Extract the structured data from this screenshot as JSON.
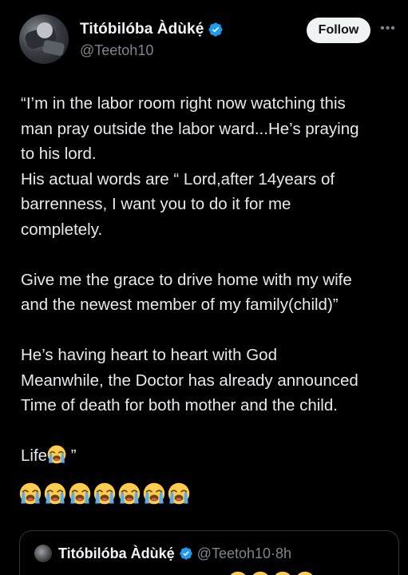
{
  "author": {
    "display_name": "Titóbilóba Àdùkẹ́",
    "handle": "@Teetoh10",
    "verified_icon": "verified-badge-icon",
    "avatar": "avatar-image"
  },
  "actions": {
    "follow_label": "Follow",
    "more_icon": "more-options-icon"
  },
  "tweet": {
    "lines": [
      "“I’m in the labor room right now watching this",
      "man pray outside the labor ward...He’s praying",
      "to his lord.",
      "His actual words are “ Lord,after 14years of",
      "barrenness, I want you to do it for me",
      "completely.",
      "",
      "Give me the grace to drive home with my wife",
      "and the newest member of my family(child)”",
      "",
      "He’s having heart to heart with God",
      "Meanwhile, the Doctor has already announced",
      "Time of death for both mother and the child.",
      ""
    ],
    "life_word": "Life",
    "life_close_quote": " ”",
    "crying_emoji_count": 7,
    "emoji_icon": "loudly-crying-face-icon"
  },
  "quoted_tweet": {
    "display_name": "Titóbilóba Àdùkẹ́",
    "handle": "@Teetoh10",
    "separator": " · ",
    "time": "8h"
  },
  "colors": {
    "background": "#000000",
    "text": "#e7e9ea",
    "muted": "#7d858c",
    "verified_blue": "#1d9bf0",
    "follow_bg": "#eff3f4",
    "border": "#2f3336"
  }
}
